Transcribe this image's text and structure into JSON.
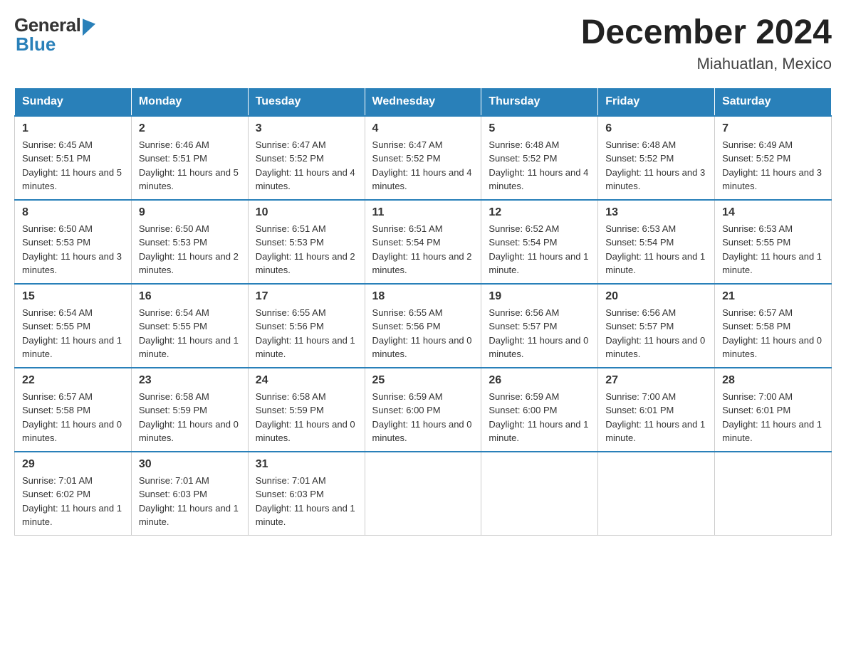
{
  "header": {
    "title": "December 2024",
    "subtitle": "Miahuatlan, Mexico",
    "logo_general": "General",
    "logo_blue": "Blue"
  },
  "calendar": {
    "days_of_week": [
      "Sunday",
      "Monday",
      "Tuesday",
      "Wednesday",
      "Thursday",
      "Friday",
      "Saturday"
    ],
    "weeks": [
      [
        {
          "day": "1",
          "sunrise": "6:45 AM",
          "sunset": "5:51 PM",
          "daylight": "11 hours and 5 minutes."
        },
        {
          "day": "2",
          "sunrise": "6:46 AM",
          "sunset": "5:51 PM",
          "daylight": "11 hours and 5 minutes."
        },
        {
          "day": "3",
          "sunrise": "6:47 AM",
          "sunset": "5:52 PM",
          "daylight": "11 hours and 4 minutes."
        },
        {
          "day": "4",
          "sunrise": "6:47 AM",
          "sunset": "5:52 PM",
          "daylight": "11 hours and 4 minutes."
        },
        {
          "day": "5",
          "sunrise": "6:48 AM",
          "sunset": "5:52 PM",
          "daylight": "11 hours and 4 minutes."
        },
        {
          "day": "6",
          "sunrise": "6:48 AM",
          "sunset": "5:52 PM",
          "daylight": "11 hours and 3 minutes."
        },
        {
          "day": "7",
          "sunrise": "6:49 AM",
          "sunset": "5:52 PM",
          "daylight": "11 hours and 3 minutes."
        }
      ],
      [
        {
          "day": "8",
          "sunrise": "6:50 AM",
          "sunset": "5:53 PM",
          "daylight": "11 hours and 3 minutes."
        },
        {
          "day": "9",
          "sunrise": "6:50 AM",
          "sunset": "5:53 PM",
          "daylight": "11 hours and 2 minutes."
        },
        {
          "day": "10",
          "sunrise": "6:51 AM",
          "sunset": "5:53 PM",
          "daylight": "11 hours and 2 minutes."
        },
        {
          "day": "11",
          "sunrise": "6:51 AM",
          "sunset": "5:54 PM",
          "daylight": "11 hours and 2 minutes."
        },
        {
          "day": "12",
          "sunrise": "6:52 AM",
          "sunset": "5:54 PM",
          "daylight": "11 hours and 1 minute."
        },
        {
          "day": "13",
          "sunrise": "6:53 AM",
          "sunset": "5:54 PM",
          "daylight": "11 hours and 1 minute."
        },
        {
          "day": "14",
          "sunrise": "6:53 AM",
          "sunset": "5:55 PM",
          "daylight": "11 hours and 1 minute."
        }
      ],
      [
        {
          "day": "15",
          "sunrise": "6:54 AM",
          "sunset": "5:55 PM",
          "daylight": "11 hours and 1 minute."
        },
        {
          "day": "16",
          "sunrise": "6:54 AM",
          "sunset": "5:55 PM",
          "daylight": "11 hours and 1 minute."
        },
        {
          "day": "17",
          "sunrise": "6:55 AM",
          "sunset": "5:56 PM",
          "daylight": "11 hours and 1 minute."
        },
        {
          "day": "18",
          "sunrise": "6:55 AM",
          "sunset": "5:56 PM",
          "daylight": "11 hours and 0 minutes."
        },
        {
          "day": "19",
          "sunrise": "6:56 AM",
          "sunset": "5:57 PM",
          "daylight": "11 hours and 0 minutes."
        },
        {
          "day": "20",
          "sunrise": "6:56 AM",
          "sunset": "5:57 PM",
          "daylight": "11 hours and 0 minutes."
        },
        {
          "day": "21",
          "sunrise": "6:57 AM",
          "sunset": "5:58 PM",
          "daylight": "11 hours and 0 minutes."
        }
      ],
      [
        {
          "day": "22",
          "sunrise": "6:57 AM",
          "sunset": "5:58 PM",
          "daylight": "11 hours and 0 minutes."
        },
        {
          "day": "23",
          "sunrise": "6:58 AM",
          "sunset": "5:59 PM",
          "daylight": "11 hours and 0 minutes."
        },
        {
          "day": "24",
          "sunrise": "6:58 AM",
          "sunset": "5:59 PM",
          "daylight": "11 hours and 0 minutes."
        },
        {
          "day": "25",
          "sunrise": "6:59 AM",
          "sunset": "6:00 PM",
          "daylight": "11 hours and 0 minutes."
        },
        {
          "day": "26",
          "sunrise": "6:59 AM",
          "sunset": "6:00 PM",
          "daylight": "11 hours and 1 minute."
        },
        {
          "day": "27",
          "sunrise": "7:00 AM",
          "sunset": "6:01 PM",
          "daylight": "11 hours and 1 minute."
        },
        {
          "day": "28",
          "sunrise": "7:00 AM",
          "sunset": "6:01 PM",
          "daylight": "11 hours and 1 minute."
        }
      ],
      [
        {
          "day": "29",
          "sunrise": "7:01 AM",
          "sunset": "6:02 PM",
          "daylight": "11 hours and 1 minute."
        },
        {
          "day": "30",
          "sunrise": "7:01 AM",
          "sunset": "6:03 PM",
          "daylight": "11 hours and 1 minute."
        },
        {
          "day": "31",
          "sunrise": "7:01 AM",
          "sunset": "6:03 PM",
          "daylight": "11 hours and 1 minute."
        },
        null,
        null,
        null,
        null
      ]
    ]
  }
}
